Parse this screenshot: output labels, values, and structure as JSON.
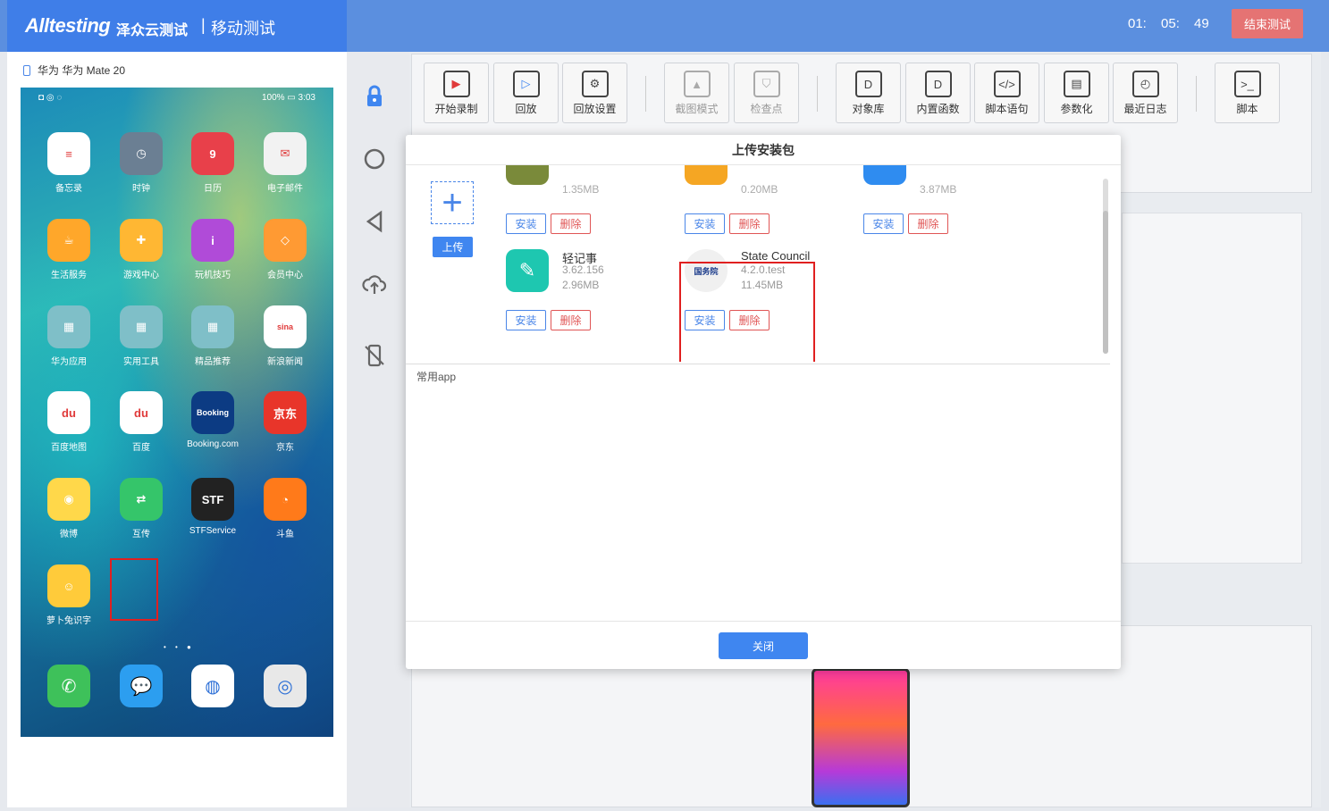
{
  "header": {
    "logo_text": "Alltesting",
    "logo_cn": "泽众云测试",
    "separator": "|",
    "module_title": "移动测试",
    "timer": "01: 05: 49",
    "end_button": "结束测试",
    "colors": {
      "header_bg": "#5b8fdf",
      "brand_bg": "#3f7ee8",
      "end_button_bg": "#e57373"
    }
  },
  "device": {
    "label": "华为 华为 Mate 20",
    "status_left": "◘ ◎ ◌",
    "status_right": "100% ▭ 3:03",
    "page_dots": "• • ●",
    "apps": [
      {
        "label": "备忘录",
        "icon": "memo-icon",
        "color": "#ffffff",
        "glyph": "≡"
      },
      {
        "label": "时钟",
        "icon": "clock-icon",
        "color": "#6b7f93",
        "glyph": "◷"
      },
      {
        "label": "日历",
        "icon": "calendar-icon",
        "color": "#e8404a",
        "glyph": "9"
      },
      {
        "label": "电子邮件",
        "icon": "mail-icon",
        "color": "#f2f2f2",
        "glyph": "✉"
      },
      {
        "label": "生活服务",
        "icon": "cup-icon",
        "color": "#ffa72a",
        "glyph": "☕"
      },
      {
        "label": "游戏中心",
        "icon": "gamepad-icon",
        "color": "#ffb733",
        "glyph": "✚"
      },
      {
        "label": "玩机技巧",
        "icon": "tips-icon",
        "color": "#b04bd8",
        "glyph": "i"
      },
      {
        "label": "会员中心",
        "icon": "diamond-icon",
        "color": "#ff9a33",
        "glyph": "◇"
      },
      {
        "label": "华为应用",
        "icon": "folder-icon",
        "color": "#7fbfc8",
        "glyph": "▦"
      },
      {
        "label": "实用工具",
        "icon": "folder-icon",
        "color": "#7fbfc8",
        "glyph": "▦"
      },
      {
        "label": "精品推荐",
        "icon": "folder-icon",
        "color": "#7fbfc8",
        "glyph": "▦"
      },
      {
        "label": "新浪新闻",
        "icon": "sina-icon",
        "color": "#ffffff",
        "glyph": "sina"
      },
      {
        "label": "百度地图",
        "icon": "map-pin-icon",
        "color": "#ffffff",
        "glyph": "du"
      },
      {
        "label": "百度",
        "icon": "baidu-icon",
        "color": "#ffffff",
        "glyph": "du"
      },
      {
        "label": "Booking.com",
        "icon": "booking-icon",
        "color": "#0c3b83",
        "glyph": "Booking"
      },
      {
        "label": "京东",
        "icon": "jd-icon",
        "color": "#e8352a",
        "glyph": "京东"
      },
      {
        "label": "微博",
        "icon": "weibo-icon",
        "color": "#ffd84a",
        "glyph": "◉"
      },
      {
        "label": "互传",
        "icon": "share-icon",
        "color": "#35c56a",
        "glyph": "⇄"
      },
      {
        "label": "STFService",
        "icon": "stf-icon",
        "color": "#222222",
        "glyph": "STF"
      },
      {
        "label": "斗鱼",
        "icon": "douyu-icon",
        "color": "#ff7a1a",
        "glyph": "◔"
      },
      {
        "label": "萝卜兔识字",
        "icon": "rabbit-icon",
        "color": "#ffcb3a",
        "glyph": "☺"
      }
    ],
    "dock": [
      {
        "icon": "phone-icon",
        "color": "#3ec15a",
        "glyph": "✆"
      },
      {
        "icon": "message-icon",
        "color": "#2c9ef0",
        "glyph": "💬"
      },
      {
        "icon": "browser-icon",
        "color": "#ffffff",
        "glyph": "◍"
      },
      {
        "icon": "camera-icon",
        "color": "#e8e8e8",
        "glyph": "◎"
      }
    ]
  },
  "ribbon": {
    "buttons": [
      {
        "label": "开始录制",
        "icon": "record-icon",
        "glyph": "▶",
        "disabled": false
      },
      {
        "label": "回放",
        "icon": "playback-icon",
        "glyph": "▷",
        "disabled": false
      },
      {
        "label": "回放设置",
        "icon": "gear-icon",
        "glyph": "⚙",
        "disabled": false
      },
      {
        "label": "截图模式",
        "icon": "image-icon",
        "glyph": "▲",
        "disabled": true
      },
      {
        "label": "检查点",
        "icon": "shield-icon",
        "glyph": "⛉",
        "disabled": true
      },
      {
        "label": "对象库",
        "icon": "doc-icon",
        "glyph": "D",
        "disabled": false
      },
      {
        "label": "内置函数",
        "icon": "doc-icon",
        "glyph": "D",
        "disabled": false
      },
      {
        "label": "脚本语句",
        "icon": "code-icon",
        "glyph": "</>",
        "disabled": false
      },
      {
        "label": "参数化",
        "icon": "grid-icon",
        "glyph": "▤",
        "disabled": false
      },
      {
        "label": "最近日志",
        "icon": "calendar-log-icon",
        "glyph": "◴",
        "disabled": false
      },
      {
        "label": "脚本",
        "icon": "terminal-icon",
        "glyph": ">_",
        "disabled": false
      }
    ]
  },
  "modal": {
    "title": "上传安装包",
    "upload_button": "上传",
    "install_label": "安装",
    "delete_label": "删除",
    "top_row": [
      {
        "size": "1.35MB",
        "color": "#7a8a3a"
      },
      {
        "size": "0.20MB",
        "color": "#f5a623"
      },
      {
        "size": "3.87MB",
        "color": "#2f8cf0"
      }
    ],
    "packages": [
      {
        "name": "轻记事",
        "version": "3.62.156",
        "size": "2.96MB",
        "icon": "pencil-icon",
        "color": "#1ec7b0",
        "glyph": "✎"
      },
      {
        "name": "State Council",
        "version": "4.2.0.test",
        "size": "11.45MB",
        "icon": "state-council-icon",
        "color": "#f0f0f0",
        "glyph": "国务院"
      }
    ],
    "section_label": "常用app",
    "close_button": "关闭"
  }
}
